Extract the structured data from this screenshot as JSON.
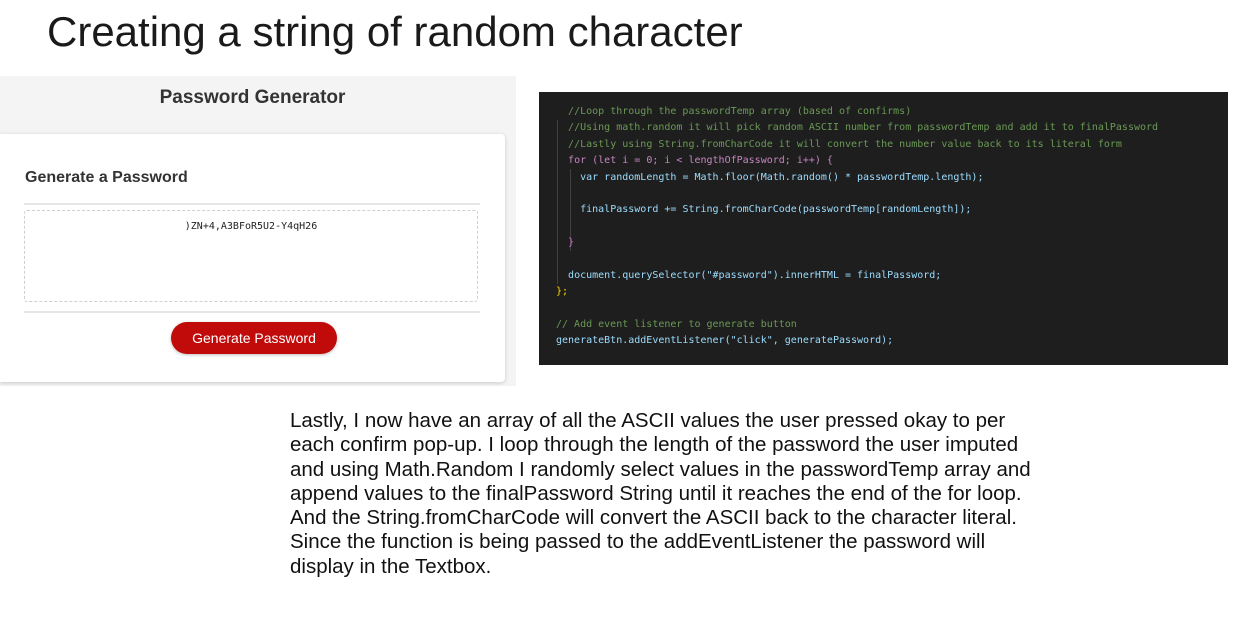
{
  "slide": {
    "title": "Creating a string of random character"
  },
  "app": {
    "header_title": "Password Generator",
    "card_title": "Generate a Password",
    "password_value": ")ZN+4,A3BFoR5U2-Y4qH26",
    "generate_button_label": "Generate Password",
    "button_color": "#c10b0b"
  },
  "code": {
    "background": "#1e1e1e",
    "lines": [
      "//Loop through the passwordTemp array (based of confirms)",
      "//Using math.random it will pick random ASCII number from passwordTemp and add it to finalPassword",
      "//Lastly using String.fromCharCode it will convert the number value back to its literal form",
      "for (let i = 0; i < lengthOfPassword; i++) {",
      "var randomLength = Math.floor(Math.random() * passwordTemp.length);",
      "",
      "finalPassword += String.fromCharCode(passwordTemp[randomLength]);",
      "",
      "}",
      "",
      "document.querySelector(\"#password\").innerHTML = finalPassword;",
      "};",
      "",
      "// Add event listener to generate button",
      "generateBtn.addEventListener(\"click\", generatePassword);"
    ]
  },
  "explanation": {
    "lines": [
      "Lastly, I now have an array of all the ASCII values the user pressed okay to per",
      "each confirm pop-up. I loop through the length of the password the user imputed",
      "and using Math.Random I randomly select values in the passwordTemp array and",
      "append values to the finalPassword String until it reaches the end of the for loop.",
      "And the String.fromCharCode will convert the ASCII back to the character literal.",
      "Since the function is being passed to the addEventListener the password will",
      "display in the Textbox."
    ]
  }
}
